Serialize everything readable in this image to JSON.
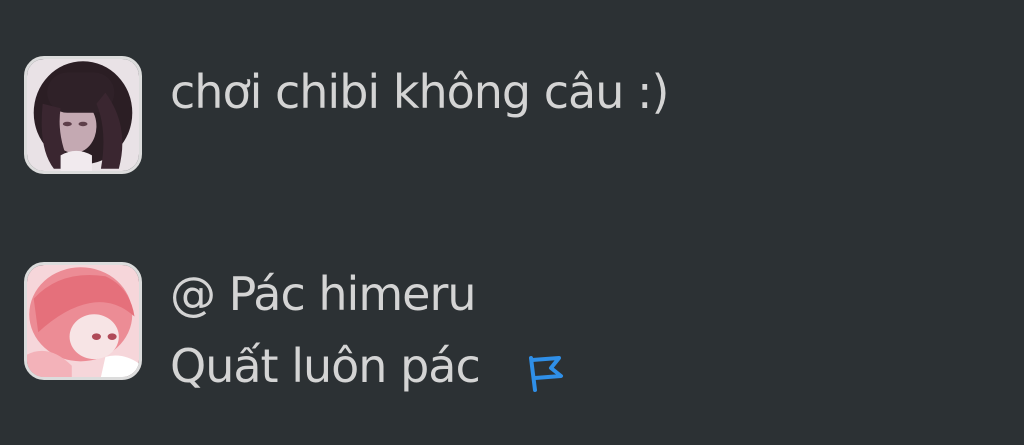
{
  "messages": [
    {
      "avatar": "dark-haired-girl-avatar",
      "lines": [
        "chơi chibi không câu :)"
      ]
    },
    {
      "avatar": "pink-haired-girl-avatar",
      "lines": [
        "@ Pác himeru",
        "Quất luôn pác"
      ],
      "reaction_icon": "flag-icon"
    }
  ],
  "colors": {
    "background": "#2c3134",
    "text": "#d4d4d4",
    "flag": "#2f8fe8"
  }
}
